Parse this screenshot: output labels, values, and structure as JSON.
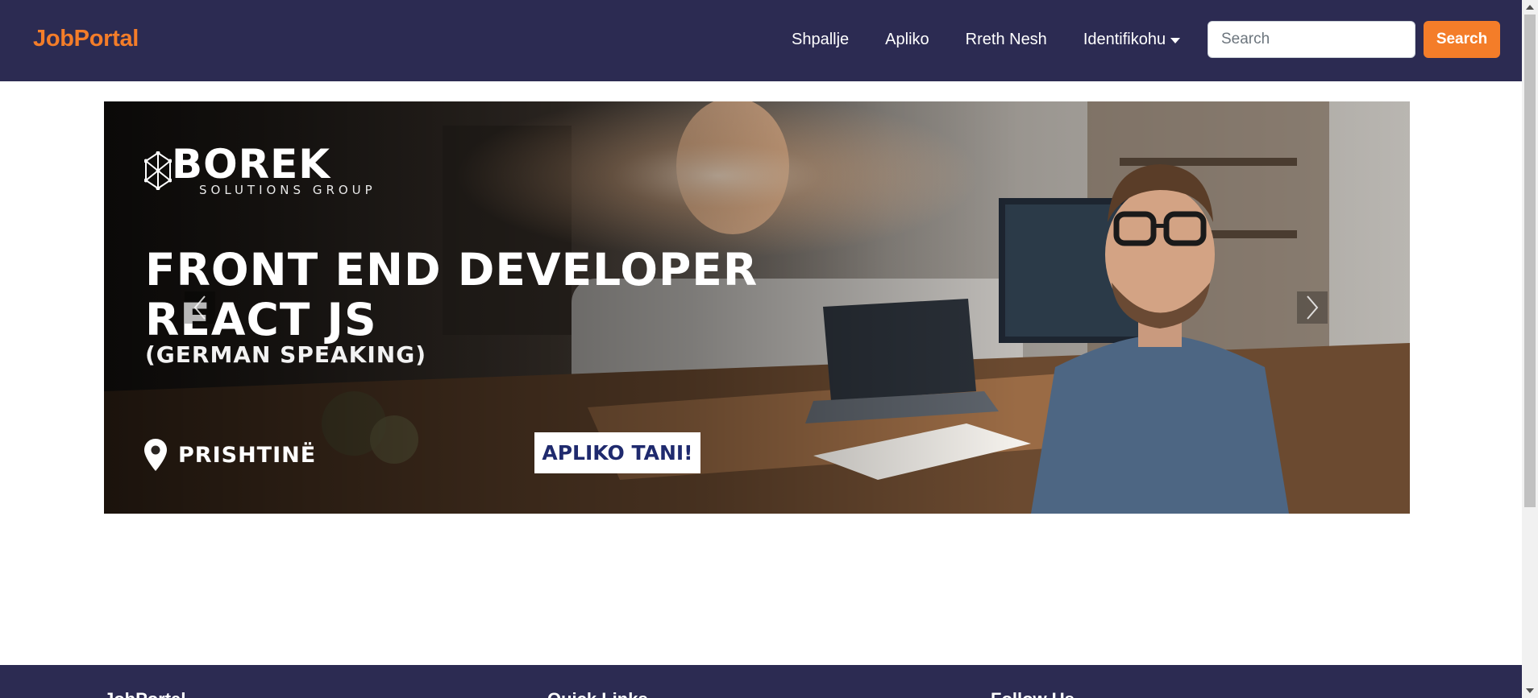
{
  "navbar": {
    "brand": "JobPortal",
    "links": [
      "Shpallje",
      "Apliko",
      "Rreth Nesh"
    ],
    "dropdown_label": "Identifikohu",
    "search": {
      "placeholder": "Search",
      "value": ""
    },
    "search_button": "Search"
  },
  "carousel": {
    "slide": {
      "company_name": "BOREK",
      "company_sub": "SOLUTIONS GROUP",
      "title_line1": "FRONT END DEVELOPER",
      "title_line2": "REACT JS",
      "language": "(GERMAN SPEAKING)",
      "location": "PRISHTINË",
      "cta": "APLIKO TANI!"
    },
    "prev_icon": "chevron-left-icon",
    "next_icon": "chevron-right-icon"
  },
  "footer": {
    "headings": [
      "JobPortal",
      "Quick Links",
      "Follow Us"
    ]
  },
  "colors": {
    "navbar": "#2c2b52",
    "accent": "#f47d29",
    "cta_text": "#1f2a6e"
  }
}
